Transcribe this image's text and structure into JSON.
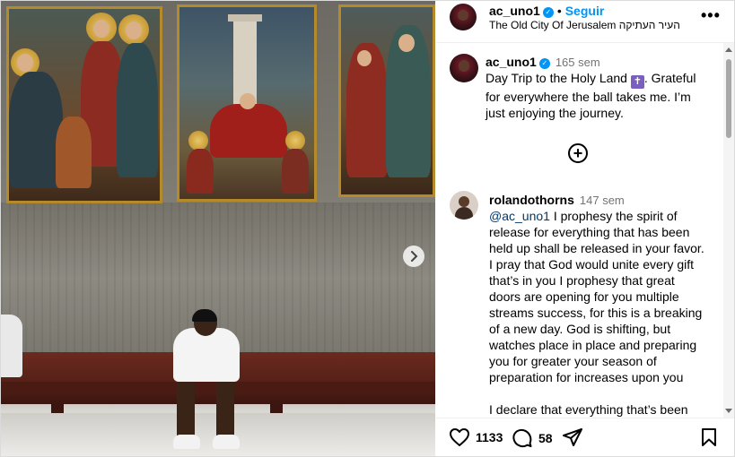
{
  "post": {
    "image_alt": "",
    "next_icon": "chevron-right-icon"
  },
  "header": {
    "username": "ac_uno1",
    "verified_icon": "verified-badge-icon",
    "separator": "•",
    "follow_label": "Seguir",
    "location": "The Old City Of Jerusalem העיר העתיקה",
    "more_icon": "more-options-icon"
  },
  "caption": {
    "username": "ac_uno1",
    "time": "165 sem",
    "text_before": "Day Trip to the Holy Land ",
    "emoji": "✝",
    "text_after": ". Grateful for everywhere the ball takes me. I’m just enjoying the journey."
  },
  "load_more_icon": "plus-circle-icon",
  "comment": {
    "username": "rolandothorns",
    "time": "147 sem",
    "mention": "@ac_uno1",
    "text": " I prophesy the spirit of release for everything that has been held up shall be released in your favor. I pray that God would unite every gift that’s in you I prophesy that great doors are opening for you multiple streams success, for this is a breaking of a new day. God is shifting, but watches place in place and preparing you for greater your season of preparation for increases upon you",
    "text2": "I declare that everything that’s been blocking your ability and your"
  },
  "actions": {
    "like_count": "1133",
    "comment_count": "58",
    "like_icon": "heart-icon",
    "comment_icon": "comment-icon",
    "share_icon": "share-icon",
    "save_icon": "bookmark-icon"
  },
  "colors": {
    "accent": "#0095f6",
    "mention": "#00376b",
    "muted": "#737373"
  }
}
